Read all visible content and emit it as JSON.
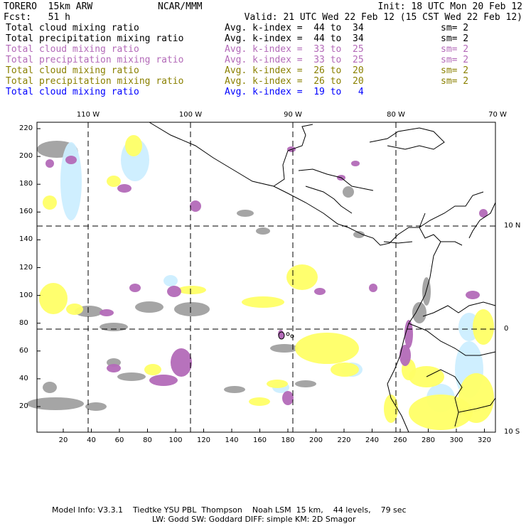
{
  "header": {
    "model": "TORERO  15km ARW",
    "org": "NCAR/MMM",
    "init": "Init: 18 UTC Mon 20 Feb 12",
    "fcst": "Fcst:   51 h",
    "valid": "Valid: 21 UTC Wed 22 Feb 12 (15 CST Wed 22 Feb 12)"
  },
  "legend": [
    {
      "field": "Total cloud mixing ratio",
      "kindex": "Avg. k-index =  44 to  34",
      "sm": "sm= 2",
      "color": "#000000"
    },
    {
      "field": "Total precipitation mixing ratio",
      "kindex": "Avg. k-index =  44 to  34",
      "sm": "sm= 2",
      "color": "#000000"
    },
    {
      "field": "Total cloud mixing ratio",
      "kindex": "Avg. k-index =  33 to  25",
      "sm": "sm= 2",
      "color": "#b36ab8"
    },
    {
      "field": "Total precipitation mixing ratio",
      "kindex": "Avg. k-index =  33 to  25",
      "sm": "sm= 2",
      "color": "#b36ab8"
    },
    {
      "field": "Total cloud mixing ratio",
      "kindex": "Avg. k-index =  26 to  20",
      "sm": "sm= 2",
      "color": "#8a8000"
    },
    {
      "field": "Total precipitation mixing ratio",
      "kindex": "Avg. k-index =  26 to  20",
      "sm": "sm= 2",
      "color": "#8a8000"
    },
    {
      "field": "Total cloud mixing ratio",
      "kindex": "Avg. k-index =  19 to   4",
      "sm": "",
      "color": "#0000ff"
    }
  ],
  "map": {
    "top_labels": [
      "110 W",
      "100 W",
      "90 W",
      "80 W",
      "70 W"
    ],
    "right_labels": [
      "10 N",
      "0",
      "10 S"
    ],
    "x_ticks": [
      "20",
      "40",
      "60",
      "80",
      "100",
      "120",
      "140",
      "160",
      "180",
      "200",
      "220",
      "240",
      "260",
      "280",
      "300",
      "320"
    ],
    "y_ticks": [
      "220",
      "200",
      "180",
      "160",
      "140",
      "120",
      "100",
      "80",
      "60",
      "40",
      "20"
    ],
    "colors": {
      "gray": "#a0a0a0",
      "purple": "#b36ab8",
      "yellow": "#ffff66",
      "lightblue": "#cceeff"
    }
  },
  "footer": {
    "line1": "Model Info: V3.3.1    Tiedtke YSU PBL  Thompson    Noah LSM  15 km,    44 levels,    79 sec",
    "line2": "LW: Godd SW: Goddard DIFF: simple KM: 2D Smagor"
  }
}
